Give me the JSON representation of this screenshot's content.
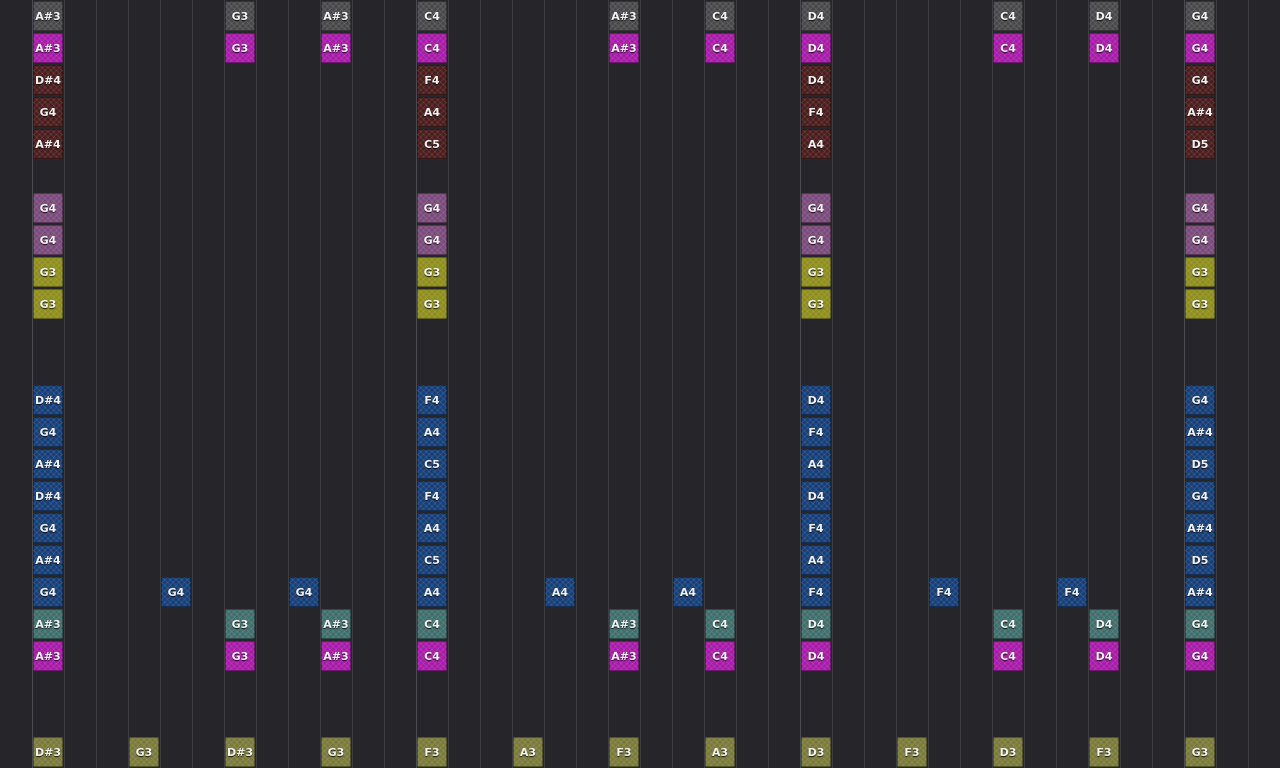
{
  "colors": {
    "background": "#26262a",
    "gray": "#48484c",
    "magenta": "#a81aa8",
    "brown": "#4a1c1c",
    "pink": "#7a4a7a",
    "olive": "#8e8e1c",
    "blue": "#163f78",
    "teal": "#3f6e6c",
    "khaki": "#7a7a3a"
  },
  "rows": [
    {
      "row": 0,
      "color": "gray",
      "notes": [
        [
          1,
          "A#3"
        ],
        [
          7,
          "G3"
        ],
        [
          10,
          "A#3"
        ],
        [
          13,
          "C4"
        ],
        [
          19,
          "A#3"
        ],
        [
          22,
          "C4"
        ],
        [
          25,
          "D4"
        ],
        [
          31,
          "C4"
        ],
        [
          34,
          "D4"
        ],
        [
          37,
          "G4"
        ]
      ]
    },
    {
      "row": 1,
      "color": "magenta",
      "notes": [
        [
          1,
          "A#3"
        ],
        [
          7,
          "G3"
        ],
        [
          10,
          "A#3"
        ],
        [
          13,
          "C4"
        ],
        [
          19,
          "A#3"
        ],
        [
          22,
          "C4"
        ],
        [
          25,
          "D4"
        ],
        [
          31,
          "C4"
        ],
        [
          34,
          "D4"
        ],
        [
          37,
          "G4"
        ]
      ]
    },
    {
      "row": 2,
      "color": "brown",
      "notes": [
        [
          1,
          "D#4"
        ],
        [
          13,
          "F4"
        ],
        [
          25,
          "D4"
        ],
        [
          37,
          "G4"
        ]
      ]
    },
    {
      "row": 3,
      "color": "brown",
      "notes": [
        [
          1,
          "G4"
        ],
        [
          13,
          "A4"
        ],
        [
          25,
          "F4"
        ],
        [
          37,
          "A#4"
        ]
      ]
    },
    {
      "row": 4,
      "color": "brown",
      "notes": [
        [
          1,
          "A#4"
        ],
        [
          13,
          "C5"
        ],
        [
          25,
          "A4"
        ],
        [
          37,
          "D5"
        ]
      ]
    },
    {
      "row": 6,
      "color": "pink",
      "notes": [
        [
          1,
          "G4"
        ],
        [
          13,
          "G4"
        ],
        [
          25,
          "G4"
        ],
        [
          37,
          "G4"
        ]
      ]
    },
    {
      "row": 7,
      "color": "pink",
      "notes": [
        [
          1,
          "G4"
        ],
        [
          13,
          "G4"
        ],
        [
          25,
          "G4"
        ],
        [
          37,
          "G4"
        ]
      ]
    },
    {
      "row": 8,
      "color": "olive",
      "notes": [
        [
          1,
          "G3"
        ],
        [
          13,
          "G3"
        ],
        [
          25,
          "G3"
        ],
        [
          37,
          "G3"
        ]
      ]
    },
    {
      "row": 9,
      "color": "olive",
      "notes": [
        [
          1,
          "G3"
        ],
        [
          13,
          "G3"
        ],
        [
          25,
          "G3"
        ],
        [
          37,
          "G3"
        ]
      ]
    },
    {
      "row": 12,
      "color": "blue",
      "notes": [
        [
          1,
          "D#4"
        ],
        [
          13,
          "F4"
        ],
        [
          25,
          "D4"
        ],
        [
          37,
          "G4"
        ]
      ]
    },
    {
      "row": 13,
      "color": "blue",
      "notes": [
        [
          1,
          "G4"
        ],
        [
          13,
          "A4"
        ],
        [
          25,
          "F4"
        ],
        [
          37,
          "A#4"
        ]
      ]
    },
    {
      "row": 14,
      "color": "blue",
      "notes": [
        [
          1,
          "A#4"
        ],
        [
          13,
          "C5"
        ],
        [
          25,
          "A4"
        ],
        [
          37,
          "D5"
        ]
      ]
    },
    {
      "row": 15,
      "color": "blue",
      "notes": [
        [
          1,
          "D#4"
        ],
        [
          13,
          "F4"
        ],
        [
          25,
          "D4"
        ],
        [
          37,
          "G4"
        ]
      ]
    },
    {
      "row": 16,
      "color": "blue",
      "notes": [
        [
          1,
          "G4"
        ],
        [
          13,
          "A4"
        ],
        [
          25,
          "F4"
        ],
        [
          37,
          "A#4"
        ]
      ]
    },
    {
      "row": 17,
      "color": "blue",
      "notes": [
        [
          1,
          "A#4"
        ],
        [
          13,
          "C5"
        ],
        [
          25,
          "A4"
        ],
        [
          37,
          "D5"
        ]
      ]
    },
    {
      "row": 18,
      "color": "blue",
      "notes": [
        [
          1,
          "G4"
        ],
        [
          5,
          "G4"
        ],
        [
          9,
          "G4"
        ],
        [
          13,
          "A4"
        ],
        [
          17,
          "A4"
        ],
        [
          21,
          "A4"
        ],
        [
          25,
          "F4"
        ],
        [
          29,
          "F4"
        ],
        [
          33,
          "F4"
        ],
        [
          37,
          "A#4"
        ]
      ]
    },
    {
      "row": 19,
      "color": "teal",
      "notes": [
        [
          1,
          "A#3"
        ],
        [
          7,
          "G3"
        ],
        [
          10,
          "A#3"
        ],
        [
          13,
          "C4"
        ],
        [
          19,
          "A#3"
        ],
        [
          22,
          "C4"
        ],
        [
          25,
          "D4"
        ],
        [
          31,
          "C4"
        ],
        [
          34,
          "D4"
        ],
        [
          37,
          "G4"
        ]
      ]
    },
    {
      "row": 20,
      "color": "magenta",
      "notes": [
        [
          1,
          "A#3"
        ],
        [
          7,
          "G3"
        ],
        [
          10,
          "A#3"
        ],
        [
          13,
          "C4"
        ],
        [
          19,
          "A#3"
        ],
        [
          22,
          "C4"
        ],
        [
          25,
          "D4"
        ],
        [
          31,
          "C4"
        ],
        [
          34,
          "D4"
        ],
        [
          37,
          "G4"
        ]
      ]
    },
    {
      "row": 23,
      "color": "khaki",
      "notes": [
        [
          1,
          "D#3"
        ],
        [
          4,
          "G3"
        ],
        [
          7,
          "D#3"
        ],
        [
          10,
          "G3"
        ],
        [
          13,
          "F3"
        ],
        [
          16,
          "A3"
        ],
        [
          19,
          "F3"
        ],
        [
          22,
          "A3"
        ],
        [
          25,
          "D3"
        ],
        [
          28,
          "F3"
        ],
        [
          31,
          "D3"
        ],
        [
          34,
          "F3"
        ],
        [
          37,
          "G3"
        ]
      ]
    }
  ]
}
